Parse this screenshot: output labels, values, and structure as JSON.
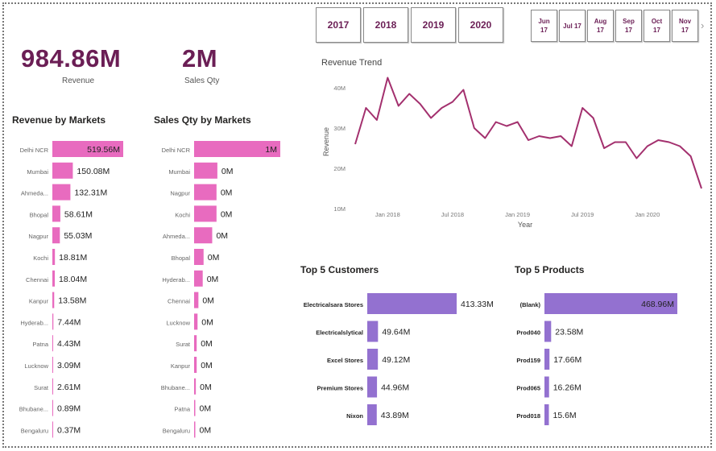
{
  "kpis": {
    "revenue": {
      "value": "984.86M",
      "label": "Revenue"
    },
    "sales_qty": {
      "value": "2M",
      "label": "Sales Qty"
    }
  },
  "slicers": {
    "years": [
      "2017",
      "2018",
      "2019",
      "2020"
    ],
    "months": [
      {
        "line1": "Jun",
        "line2": "17"
      },
      {
        "line1": "Jul 17",
        "line2": ""
      },
      {
        "line1": "Aug",
        "line2": "17"
      },
      {
        "line1": "Sep",
        "line2": "17"
      },
      {
        "line1": "Oct",
        "line2": "17"
      },
      {
        "line1": "Nov",
        "line2": "17"
      }
    ],
    "next_icon": "chevron-right-icon"
  },
  "colors": {
    "pink": "#e86bbf",
    "purple": "#9371d0",
    "line": "#a3306e",
    "kpi": "#6b1e55"
  },
  "chart_data": [
    {
      "id": "revenue_by_markets",
      "type": "bar",
      "orientation": "horizontal",
      "title": "Revenue by Markets",
      "categories": [
        "Delhi NCR",
        "Mumbai",
        "Ahmeda...",
        "Bhopal",
        "Nagpur",
        "Kochi",
        "Chennai",
        "Kanpur",
        "Hyderab...",
        "Patna",
        "Lucknow",
        "Surat",
        "Bhubane...",
        "Bengaluru"
      ],
      "values": [
        519.56,
        150.08,
        132.31,
        58.61,
        55.03,
        18.81,
        18.04,
        13.58,
        7.44,
        4.43,
        3.09,
        2.61,
        0.89,
        0.37
      ],
      "data_labels": [
        "519.56M",
        "150.08M",
        "132.31M",
        "58.61M",
        "55.03M",
        "18.81M",
        "18.04M",
        "13.58M",
        "7.44M",
        "4.43M",
        "3.09M",
        "2.61M",
        "0.89M",
        "0.37M"
      ],
      "unit": "M",
      "max": 519.56
    },
    {
      "id": "sales_qty_by_markets",
      "type": "bar",
      "orientation": "horizontal",
      "title": "Sales Qty by Markets",
      "categories": [
        "Delhi NCR",
        "Mumbai",
        "Nagpur",
        "Kochi",
        "Ahmeda...",
        "Bhopal",
        "Hyderab...",
        "Chennai",
        "Lucknow",
        "Surat",
        "Kanpur",
        "Bhubane...",
        "Patna",
        "Bengaluru"
      ],
      "values": [
        1.0,
        0.27,
        0.26,
        0.26,
        0.21,
        0.11,
        0.1,
        0.05,
        0.04,
        0.03,
        0.03,
        0.02,
        0.01,
        0.005
      ],
      "data_labels": [
        "1M",
        "0M",
        "0M",
        "0M",
        "0M",
        "0M",
        "0M",
        "0M",
        "0M",
        "0M",
        "0M",
        "0M",
        "0M",
        "0M"
      ],
      "unit": "M",
      "max": 1.0
    },
    {
      "id": "revenue_trend",
      "type": "line",
      "title": "Revenue Trend",
      "xlabel": "Year",
      "ylabel": "Revenue",
      "x": [
        "2017-10",
        "2017-11",
        "2017-12",
        "2018-01",
        "2018-02",
        "2018-03",
        "2018-04",
        "2018-05",
        "2018-06",
        "2018-07",
        "2018-08",
        "2018-09",
        "2018-10",
        "2018-11",
        "2018-12",
        "2019-01",
        "2019-02",
        "2019-03",
        "2019-04",
        "2019-05",
        "2019-06",
        "2019-07",
        "2019-08",
        "2019-09",
        "2019-10",
        "2019-11",
        "2019-12",
        "2020-01",
        "2020-02",
        "2020-03",
        "2020-04",
        "2020-05",
        "2020-06"
      ],
      "values": [
        26,
        35,
        32,
        42.5,
        35.5,
        38.5,
        36,
        32.5,
        35,
        36.5,
        39.5,
        30,
        27.5,
        31.5,
        30.5,
        31.5,
        27,
        28,
        27.5,
        28,
        25.5,
        35,
        32.5,
        25,
        26.5,
        26.5,
        22.5,
        25.5,
        27,
        26.5,
        25.5,
        23,
        15
      ],
      "x_ticks": [
        "Jan 2018",
        "Jul 2018",
        "Jan 2019",
        "Jul 2019",
        "Jan 2020"
      ],
      "x_tick_dates": [
        "2018-01",
        "2018-07",
        "2019-01",
        "2019-07",
        "2020-01"
      ],
      "y_ticks": [
        "10M",
        "20M",
        "30M",
        "40M"
      ],
      "y_tick_values": [
        10,
        20,
        30,
        40
      ],
      "ylim": [
        10,
        45
      ]
    },
    {
      "id": "top5_customers",
      "type": "bar",
      "orientation": "horizontal",
      "title": "Top 5 Customers",
      "categories": [
        "Electricalsara Stores",
        "Electricalslytical",
        "Excel Stores",
        "Premium Stores",
        "Nixon"
      ],
      "values": [
        413.33,
        49.64,
        49.12,
        44.96,
        43.89
      ],
      "data_labels": [
        "413.33M",
        "49.64M",
        "49.12M",
        "44.96M",
        "43.89M"
      ],
      "unit": "M",
      "max": 413.33
    },
    {
      "id": "top5_products",
      "type": "bar",
      "orientation": "horizontal",
      "title": "Top 5 Products",
      "categories": [
        "(Blank)",
        "Prod040",
        "Prod159",
        "Prod065",
        "Prod018"
      ],
      "values": [
        468.96,
        23.58,
        17.66,
        16.26,
        15.6
      ],
      "data_labels": [
        "468.96M",
        "23.58M",
        "17.66M",
        "16.26M",
        "15.6M"
      ],
      "unit": "M",
      "max": 468.96
    }
  ]
}
